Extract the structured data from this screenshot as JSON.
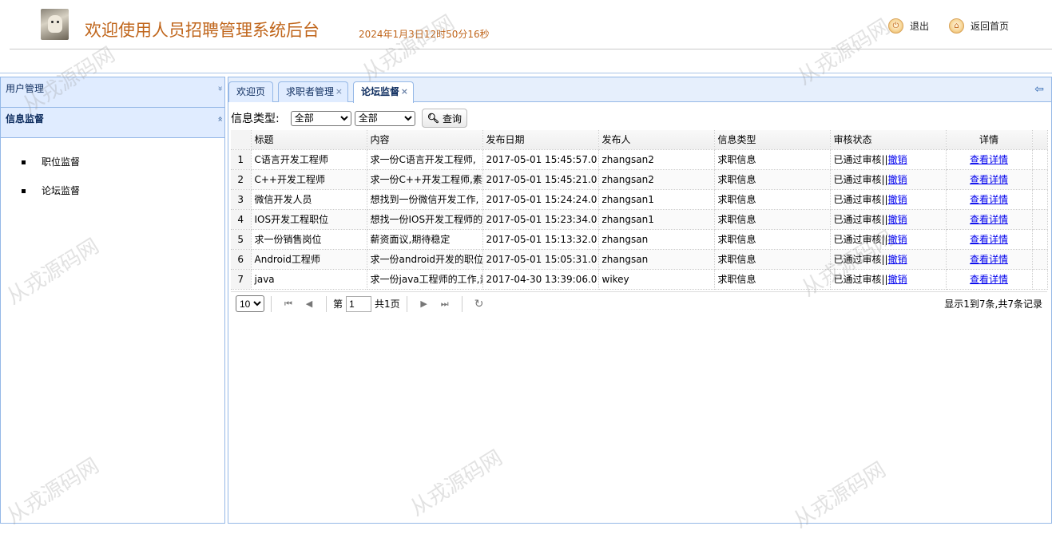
{
  "header": {
    "title": "欢迎使用人员招聘管理系统后台",
    "datetime": "2024年1月3日12时50分16秒",
    "logout_label": "退出",
    "home_label": "返回首页"
  },
  "sidebar": {
    "sections": [
      {
        "label": "用户管理",
        "chevron": "»"
      },
      {
        "label": "信息监督",
        "chevron": "«"
      }
    ],
    "items": [
      {
        "label": "职位监督"
      },
      {
        "label": "论坛监督"
      }
    ]
  },
  "tabs": [
    {
      "label": "欢迎页"
    },
    {
      "label": "求职者管理",
      "close": "×"
    },
    {
      "label": "论坛监督",
      "close": "×"
    }
  ],
  "filter": {
    "label": "信息类型:",
    "select1": "全部",
    "select2": "全部",
    "query_label": "查询"
  },
  "table": {
    "headers": [
      "标题",
      "内容",
      "发布日期",
      "发布人",
      "信息类型",
      "审核状态",
      "详情"
    ],
    "rows": [
      {
        "no": "1",
        "title": "C语言开发工程师",
        "content": "求一份C语言开发工程师,",
        "date": "2017-05-01 15:45:57.0",
        "user": "zhangsan2",
        "type": "求职信息",
        "status": "已通过审核||",
        "revoke": "撤销",
        "detail": "查看详情"
      },
      {
        "no": "2",
        "title": "C++开发工程师",
        "content": "求一份C++开发工程师,素",
        "date": "2017-05-01 15:45:21.0",
        "user": "zhangsan2",
        "type": "求职信息",
        "status": "已通过审核||",
        "revoke": "撤销",
        "detail": "查看详情"
      },
      {
        "no": "3",
        "title": "微信开发人员",
        "content": "想找到一份微信开发工作,",
        "date": "2017-05-01 15:24:24.0",
        "user": "zhangsan1",
        "type": "求职信息",
        "status": "已通过审核||",
        "revoke": "撤销",
        "detail": "查看详情"
      },
      {
        "no": "4",
        "title": "IOS开发工程职位",
        "content": "想找一份IOS开发工程师的",
        "date": "2017-05-01 15:23:34.0",
        "user": "zhangsan1",
        "type": "求职信息",
        "status": "已通过审核||",
        "revoke": "撤销",
        "detail": "查看详情"
      },
      {
        "no": "5",
        "title": "求一份销售岗位",
        "content": "薪资面议,期待稳定",
        "date": "2017-05-01 15:13:32.0",
        "user": "zhangsan",
        "type": "求职信息",
        "status": "已通过审核||",
        "revoke": "撤销",
        "detail": "查看详情"
      },
      {
        "no": "6",
        "title": "Android工程师",
        "content": "求一份android开发的职位",
        "date": "2017-05-01 15:05:31.0",
        "user": "zhangsan",
        "type": "求职信息",
        "status": "已通过审核||",
        "revoke": "撤销",
        "detail": "查看详情"
      },
      {
        "no": "7",
        "title": "java",
        "content": "求一份java工程师的工作,素",
        "date": "2017-04-30 13:39:06.0",
        "user": "wikey",
        "type": "求职信息",
        "status": "已通过审核||",
        "revoke": "撤销",
        "detail": "查看详情"
      }
    ]
  },
  "pager": {
    "page_size": "10",
    "page_prefix": "第",
    "page_value": "1",
    "page_total": "共1页",
    "info": "显示1到7条,共7条记录"
  },
  "watermark": "从戎源码网"
}
